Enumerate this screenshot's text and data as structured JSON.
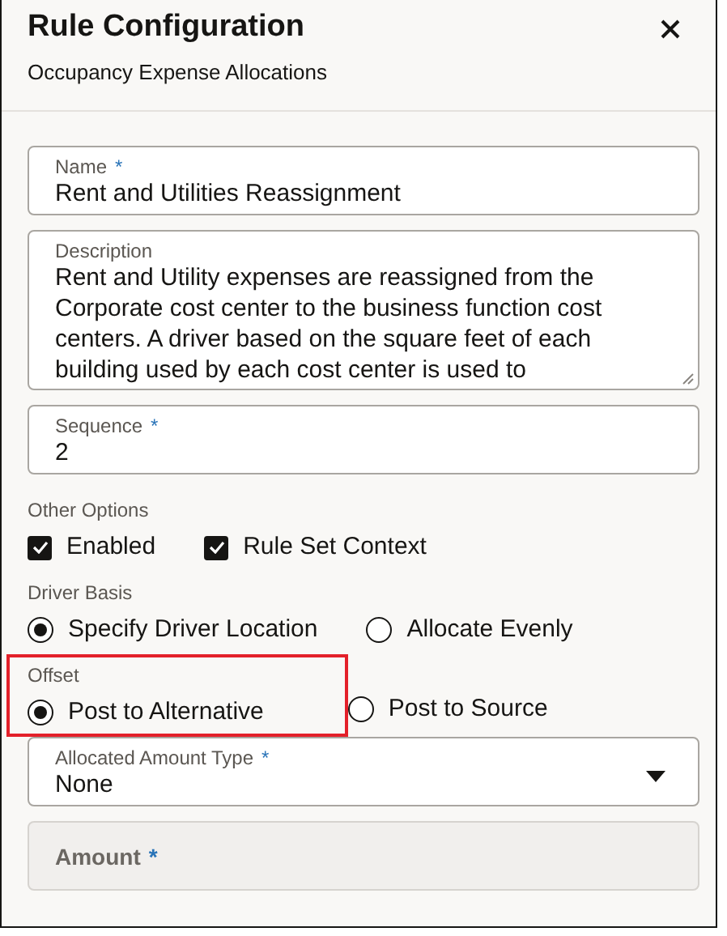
{
  "dialog": {
    "title": "Rule Configuration",
    "subtitle": "Occupancy Expense Allocations"
  },
  "form": [
    {
      "kind": "text",
      "label": "Name",
      "required_mark": "*",
      "value": "Rent and Utilities Reassignment",
      "disabled": false
    },
    {
      "kind": "textarea",
      "label": "Description",
      "value": "Rent and Utility expenses are reassigned from the Corporate cost center to the business function cost centers. A driver based on the square feet of each building used by each cost center is used to",
      "disabled": false
    },
    {
      "kind": "text",
      "label": "Sequence",
      "required_mark": "*",
      "value": "2",
      "disabled": false
    },
    {
      "kind": "checkbox-group",
      "label": "Other Options",
      "highlighted": false,
      "options": [
        {
          "label": "Enabled",
          "checked": true
        },
        {
          "label": "Rule Set Context",
          "checked": true
        }
      ]
    },
    {
      "kind": "radio-group",
      "label": "Driver Basis",
      "highlighted": false,
      "options": [
        {
          "label": "Specify Driver Location",
          "selected": true
        },
        {
          "label": "Allocate Evenly",
          "selected": false
        }
      ]
    },
    {
      "kind": "radio-group",
      "label": "Offset",
      "highlighted": true,
      "options": [
        {
          "label": "Post to Alternative",
          "selected": true
        },
        {
          "label": "Post to Source",
          "selected": false
        }
      ]
    },
    {
      "kind": "select",
      "label": "Allocated Amount Type",
      "required_mark": "*",
      "value": "None",
      "disabled": false
    },
    {
      "kind": "text",
      "label": "Amount",
      "required_mark": "*",
      "disabled": true
    }
  ]
}
